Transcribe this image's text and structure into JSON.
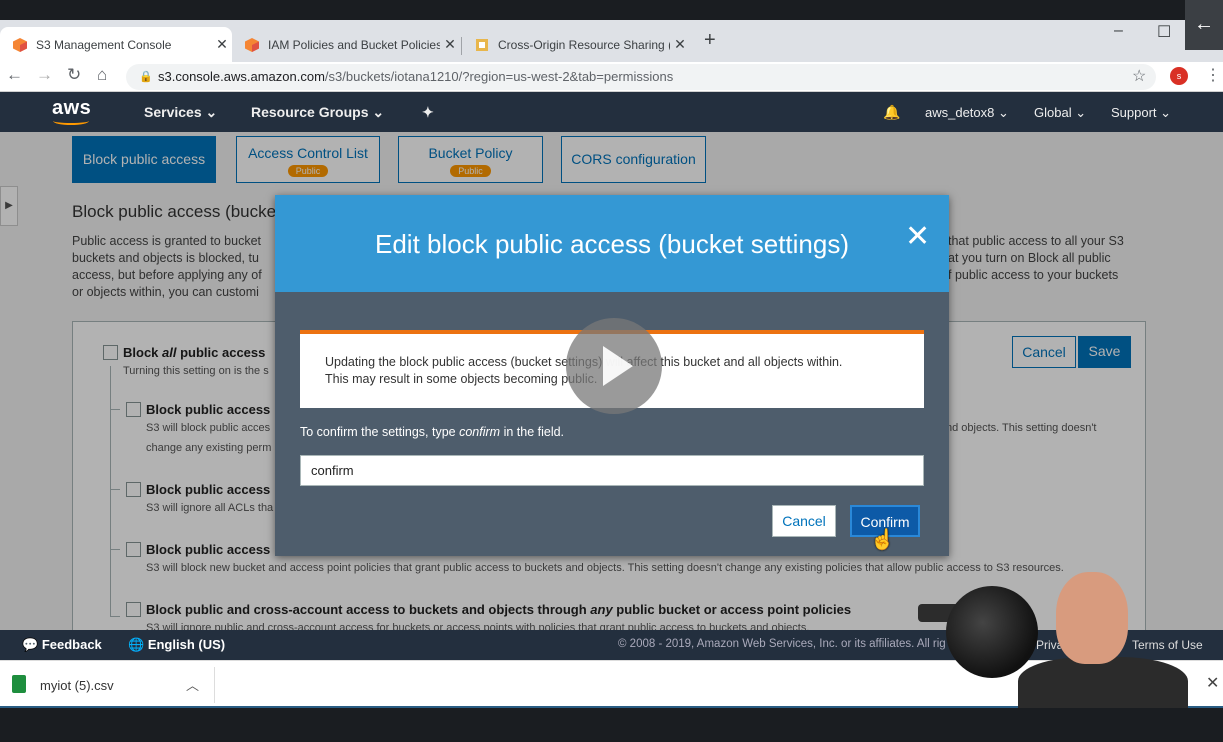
{
  "browser": {
    "tabs": [
      {
        "title": "S3 Management Console",
        "close": "✕"
      },
      {
        "title": "IAM Policies and Bucket Policies a",
        "close": "✕"
      },
      {
        "title": "Cross-Origin Resource Sharing (C",
        "close": "✕"
      }
    ],
    "new_tab": "+",
    "url_host": "s3.console.aws.amazon.com",
    "url_path": "/s3/buckets/iotana1210/?region=us-west-2&tab=permissions",
    "profile_initial": "s"
  },
  "aws_nav": {
    "logo": "aws",
    "services": "Services",
    "resource_groups": "Resource Groups",
    "account": "aws_detox8",
    "region": "Global",
    "support": "Support"
  },
  "permissions_tabs": [
    {
      "label": "Block public access"
    },
    {
      "label": "Access Control List",
      "badge": "Public"
    },
    {
      "label": "Bucket Policy",
      "badge": "Public"
    },
    {
      "label": "CORS configuration"
    }
  ],
  "section": {
    "title": "Block public access (bucke",
    "desc_left": [
      "Public access is granted to bucket",
      "buckets and objects is blocked, tu",
      "access, but before applying any of",
      "or objects within, you can customi"
    ],
    "desc_right": [
      "that public access to all your S3",
      "at you turn on Block all public",
      "f public access to your buckets"
    ]
  },
  "options": {
    "all_prefix": "Block ",
    "all_em": "all",
    "all_suffix": " public access",
    "all_desc": "Turning this setting on is the s",
    "opt1_title": "Block public access",
    "opt1_desc1": "S3 will block public acces",
    "opt1_desc1_right": "nd objects. This setting doesn't",
    "opt1_desc2": "change any existing perm",
    "opt2_title": "Block public access",
    "opt2_desc": "S3 will ignore all ACLs tha",
    "opt3_title": "Block public access",
    "opt3_desc": "S3 will block new bucket and access point policies that grant public access to buckets and objects. This setting doesn't change any existing policies that allow public access to S3 resources.",
    "opt4_prefix": "Block public and cross-account access to buckets and objects through ",
    "opt4_em": "any",
    "opt4_suffix": " public bucket or access point policies",
    "opt4_desc": "S3 will ignore public and cross-account access for buckets or access points with policies that grant public access to buckets and objects.",
    "cancel": "Cancel",
    "save": "Save"
  },
  "modal": {
    "title": "Edit block public access (bucket settings)",
    "close": "✕",
    "warning_line1": "Updating the block public access (bucket settings) will affect this bucket and all objects within.",
    "warning_line2": "This may result in some objects becoming public.",
    "confirm_prefix": "To confirm the settings, type ",
    "confirm_em": "confirm",
    "confirm_suffix": " in the field.",
    "input_value": "confirm",
    "cancel": "Cancel",
    "confirm": "Confirm"
  },
  "footer": {
    "feedback": "Feedback",
    "language": "English (US)",
    "copyright": "© 2008 - 2019, Amazon Web Services, Inc. or its affiliates. All rig",
    "privacy": "Priva",
    "terms": "Terms of Use"
  },
  "download": {
    "filename": "myiot (5).csv"
  },
  "colors": {
    "aws_nav": "#232f3e",
    "aws_orange": "#ff9900",
    "modal_header": "#3498d4",
    "primary_blue": "#0073bb"
  }
}
